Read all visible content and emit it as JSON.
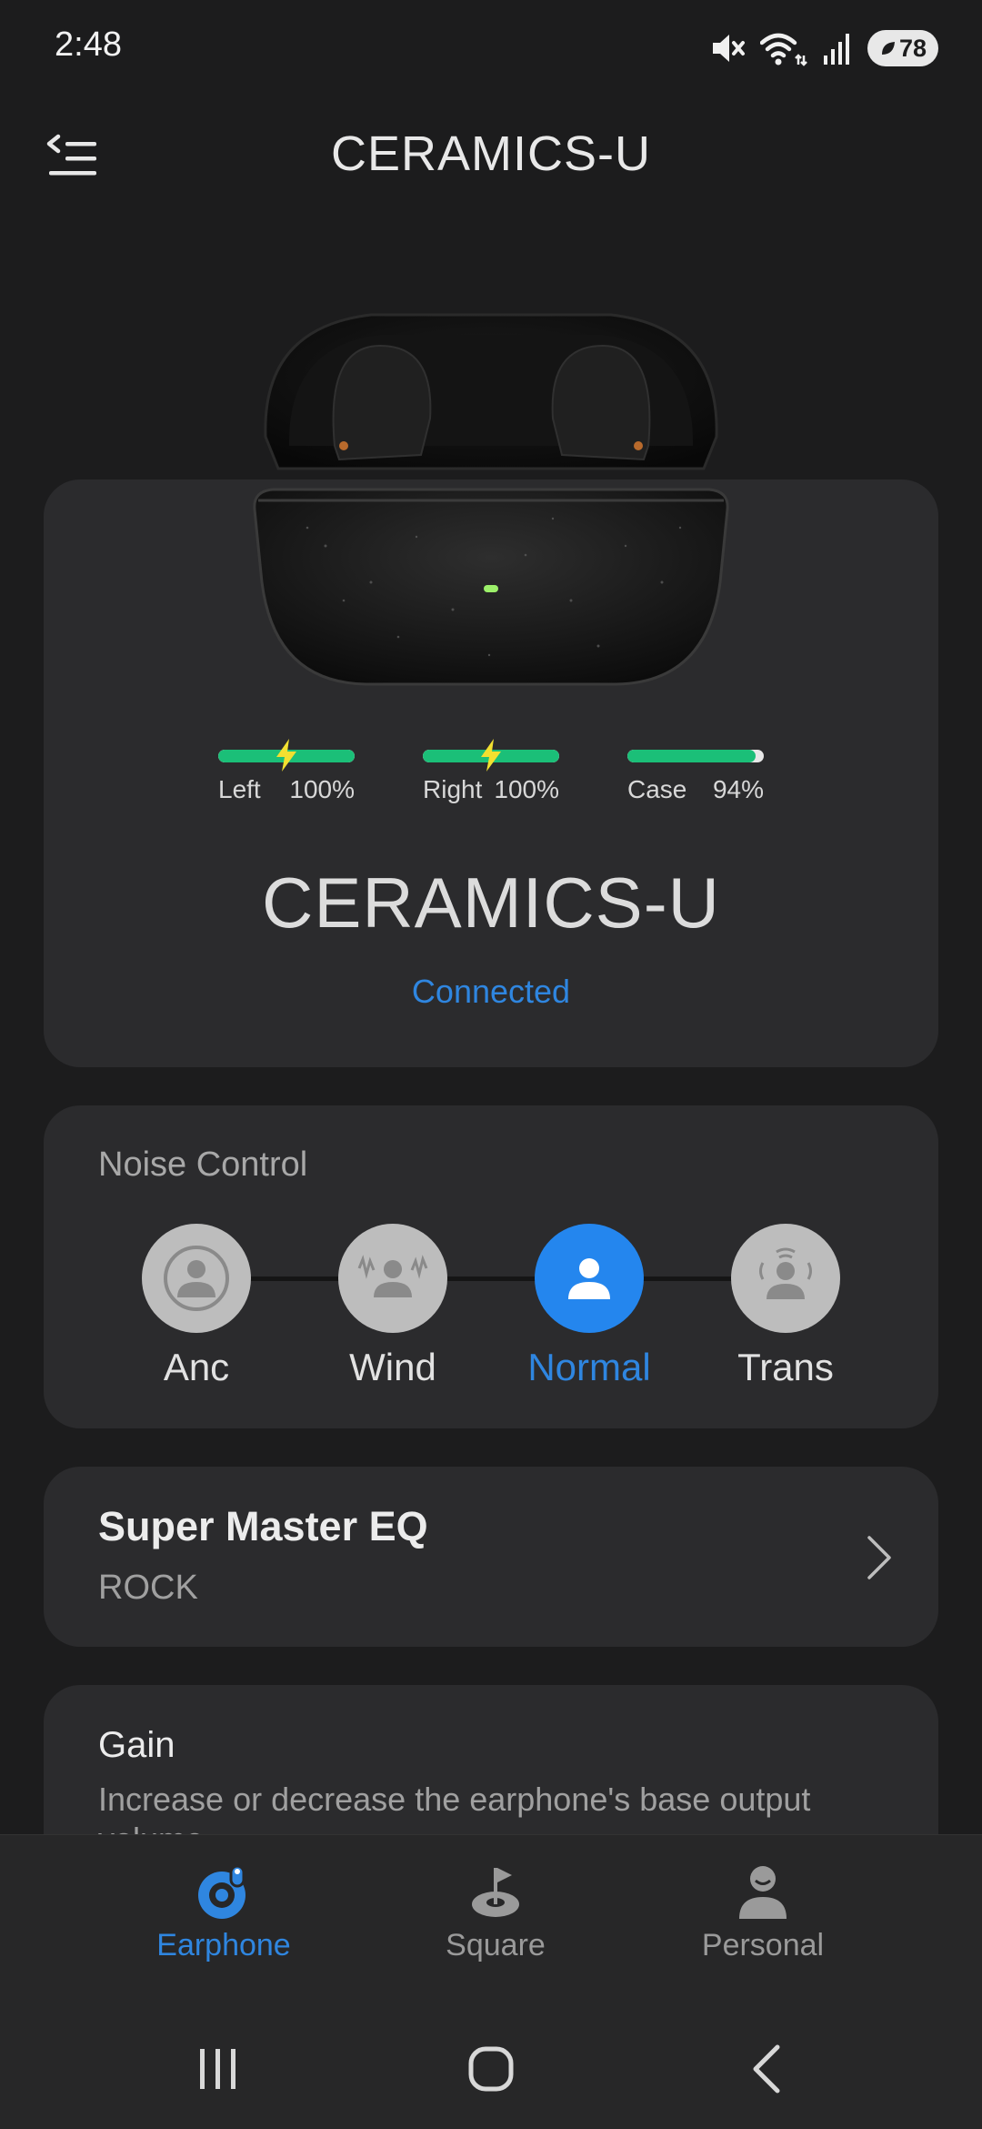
{
  "status_bar": {
    "time": "2:48",
    "battery_level": "78",
    "network_badge": "5"
  },
  "header": {
    "title": "CERAMICS-U"
  },
  "device": {
    "name": "CERAMICS-U",
    "status": "Connected",
    "batteries": [
      {
        "label": "Left",
        "percent_text": "100%",
        "level": 1.0,
        "charging": true
      },
      {
        "label": "Right",
        "percent_text": "100%",
        "level": 1.0,
        "charging": true
      },
      {
        "label": "Case",
        "percent_text": "94%",
        "level": 0.94,
        "charging": false
      }
    ]
  },
  "noise_control": {
    "title": "Noise Control",
    "modes": [
      {
        "label": "Anc",
        "icon": "anc-icon",
        "active": false
      },
      {
        "label": "Wind",
        "icon": "wind-icon",
        "active": false
      },
      {
        "label": "Normal",
        "icon": "normal-icon",
        "active": true
      },
      {
        "label": "Trans",
        "icon": "transparency-icon",
        "active": false
      }
    ]
  },
  "eq": {
    "title": "Super Master EQ",
    "value": "ROCK"
  },
  "gain": {
    "title": "Gain",
    "description": "Increase or decrease the earphone's base output volume"
  },
  "bottom_nav": {
    "items": [
      {
        "label": "Earphone",
        "icon": "earphone-icon",
        "active": true
      },
      {
        "label": "Square",
        "icon": "square-icon",
        "active": false
      },
      {
        "label": "Personal",
        "icon": "personal-icon",
        "active": false
      }
    ]
  },
  "colors": {
    "accent": "#2f86e0",
    "battery_green": "#1bbf78",
    "card_bg": "#2b2b2d",
    "page_bg": "#1c1c1d"
  }
}
